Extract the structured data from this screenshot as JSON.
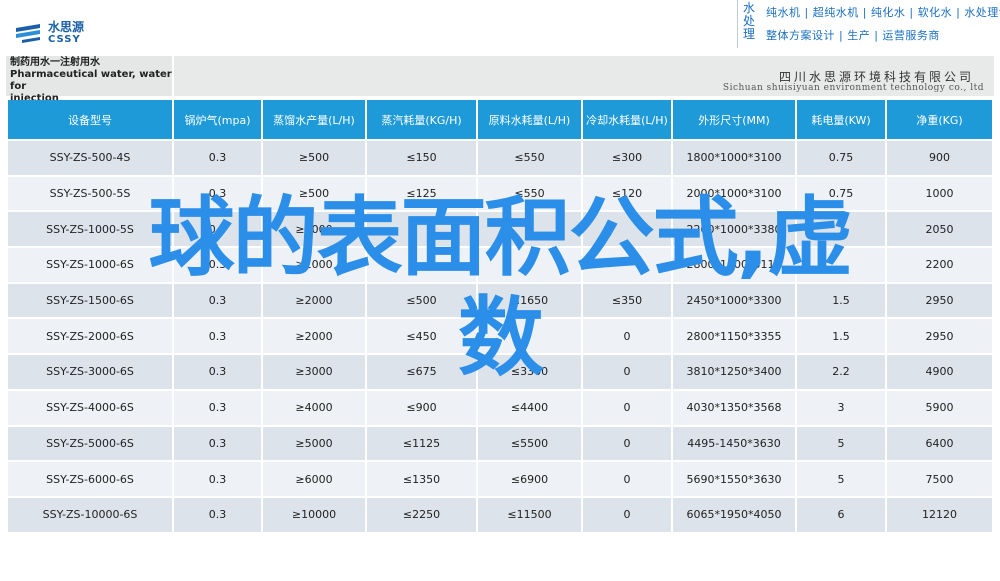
{
  "header": {
    "logo_cn": "水思源",
    "logo_en": "CSSY",
    "brand_vertical": "水处理",
    "brand_line1": "纯水机 | 超纯水机 | 纯化水 | 软化水 | 水处理设备",
    "brand_line2": "整体方案设计 | 生产 | 运营服务商"
  },
  "title": {
    "line1": "制药用水一注射用水",
    "line2": "Pharmaceutical water, water for",
    "line3": "injection",
    "corp_cn": "四川水思源环境科技有限公司",
    "corp_en": "Sichuan shuisiyuan environment technology co., ltd"
  },
  "table": {
    "headers": [
      "设备型号",
      "锅炉气(mpa)",
      "蒸馏水产量(L/H)",
      "蒸汽耗量(KG/H)",
      "原料水耗量(L/H)",
      "冷却水耗量(L/H)",
      "外形尺寸(MM)",
      "耗电量(KW)",
      "净重(KG)"
    ],
    "rows": [
      [
        "SSY-ZS-500-4S",
        "0.3",
        "≥500",
        "≤150",
        "≤550",
        "≤300",
        "1800*1000*3100",
        "0.75",
        "900"
      ],
      [
        "SSY-ZS-500-5S",
        "0.3",
        "≥500",
        "≤125",
        "≤550",
        "≤120",
        "2000*1000*3100",
        "0.75",
        "1000"
      ],
      [
        "SSY-ZS-1000-5S",
        "0.3",
        "≥1000",
        "",
        "",
        "",
        "2200*1000*3380",
        "",
        "2050"
      ],
      [
        "SSY-ZS-1000-6S",
        "0.3",
        "≥1000",
        "",
        "",
        "",
        "2800*1000*3118",
        "",
        "2200"
      ],
      [
        "SSY-ZS-1500-6S",
        "0.3",
        "≥2000",
        "≤500",
        "≤1650",
        "≤350",
        "2450*1000*3300",
        "1.5",
        "2950"
      ],
      [
        "SSY-ZS-2000-6S",
        "0.3",
        "≥2000",
        "≤450",
        "",
        "0",
        "2800*1150*3355",
        "1.5",
        "2950"
      ],
      [
        "SSY-ZS-3000-6S",
        "0.3",
        "≥3000",
        "≤675",
        "≤3300",
        "0",
        "3810*1250*3400",
        "2.2",
        "4900"
      ],
      [
        "SSY-ZS-4000-6S",
        "0.3",
        "≥4000",
        "≤900",
        "≤4400",
        "0",
        "4030*1350*3568",
        "3",
        "5900"
      ],
      [
        "SSY-ZS-5000-6S",
        "0.3",
        "≥5000",
        "≤1125",
        "≤5500",
        "0",
        "4495-1450*3630",
        "5",
        "6400"
      ],
      [
        "SSY-ZS-6000-6S",
        "0.3",
        "≥6000",
        "≤1350",
        "≤6900",
        "0",
        "5690*1550*3630",
        "5",
        "7500"
      ],
      [
        "SSY-ZS-10000-6S",
        "0.3",
        "≥10000",
        "≤2250",
        "≤11500",
        "0",
        "6065*1950*4050",
        "6",
        "12120"
      ]
    ]
  },
  "watermark": {
    "line1": "球的表面积公式,虚",
    "line2": "数"
  },
  "colors": {
    "header_blue": "#1e9ad9",
    "watermark_blue": "#2b8ee8"
  }
}
